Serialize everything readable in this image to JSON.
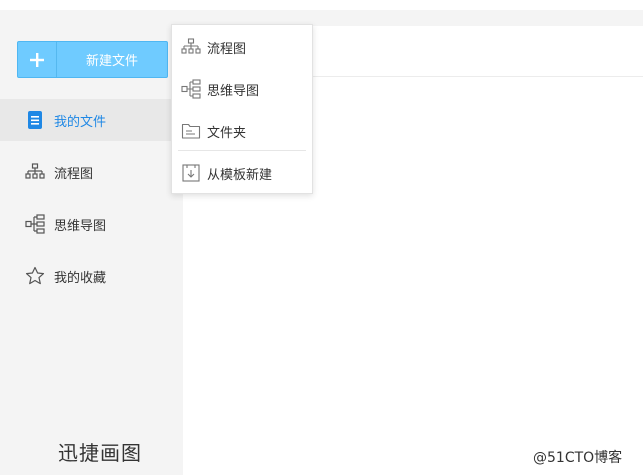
{
  "sidebar": {
    "new_file_label": "新建文件",
    "items": [
      {
        "label": "我的文件",
        "icon": "document-icon",
        "active": true
      },
      {
        "label": "流程图",
        "icon": "flowchart-icon"
      },
      {
        "label": "思维导图",
        "icon": "mindmap-icon"
      },
      {
        "label": "我的收藏",
        "icon": "star-icon"
      }
    ],
    "brand": "迅捷画图"
  },
  "dropdown": {
    "items": [
      {
        "label": "流程图",
        "icon": "flowchart-icon"
      },
      {
        "label": "思维导图",
        "icon": "mindmap-icon"
      },
      {
        "label": "文件夹",
        "icon": "folder-icon"
      },
      {
        "label": "从模板新建",
        "icon": "template-icon"
      }
    ]
  },
  "watermark": "@51CTO博客",
  "colors": {
    "accent": "#6fcbff",
    "active_text": "#1f88e5",
    "sidebar_bg": "#f4f4f4"
  }
}
